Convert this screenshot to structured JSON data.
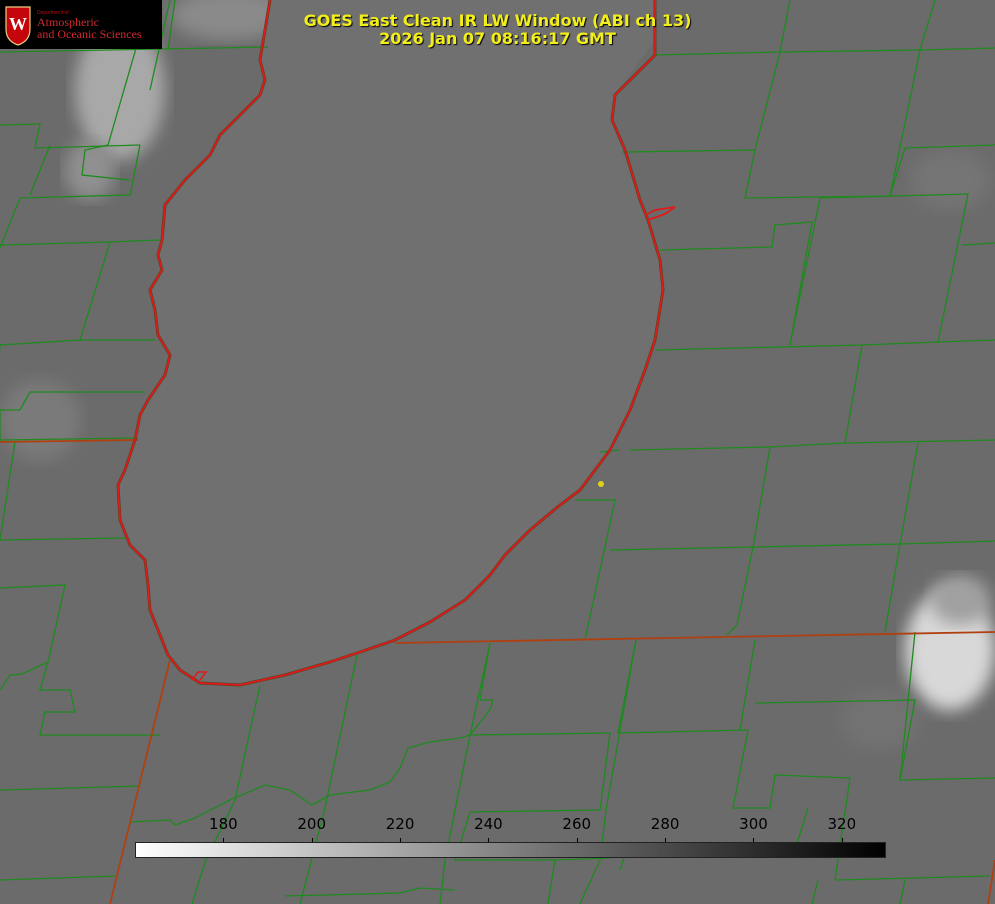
{
  "title": {
    "line1": "GOES East Clean IR LW Window (ABI ch 13)",
    "line2": "2026 Jan 07 08:16:17 GMT"
  },
  "logo": {
    "crest_letter": "W",
    "department": "Department of",
    "line1": "Atmospheric",
    "line2": "and Oceanic Sciences"
  },
  "colorbar": {
    "min": 160,
    "max": 330,
    "ticks": [
      "180",
      "200",
      "220",
      "240",
      "260",
      "280",
      "300",
      "320"
    ],
    "gradient_start": "#ffffff",
    "gradient_end": "#000000"
  },
  "colors": {
    "title_text": "#f2ee1a",
    "county_border": "#1f8a1f",
    "lake_shoreline": "#e01a1a",
    "state_border": "#b04010",
    "station_marker": "#e0d01a"
  },
  "map": {
    "feature": "lake",
    "station_marker": "yellow dot"
  }
}
